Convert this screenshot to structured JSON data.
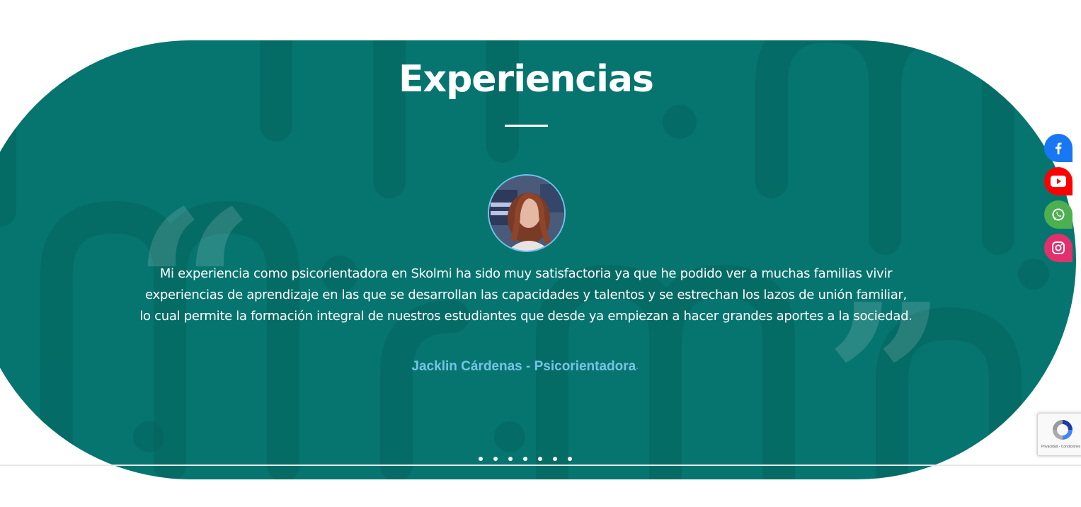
{
  "section": {
    "title": "Experiencias",
    "background_color": "#06756f",
    "accent_color": "#74c4e4"
  },
  "testimonial": {
    "quote": "Mi experiencia como psicorientadora en Skolmi ha sido muy satisfactoria ya que he podido ver a muchas familias vivir experiencias de aprendizaje en las que se desarrollan las capacidades y talentos y se estrechan los lazos de unión familiar, lo cual permite la formación integral de nuestros estudiantes que desde ya empiezan a hacer grandes aportes a la sociedad.",
    "author": "Jacklin Cárdenas - Psicorientadora",
    "author_separator": "-",
    "open_quote_glyph": "“",
    "close_quote_glyph": "”"
  },
  "carousel": {
    "dot_count": 7,
    "active_index": 0
  },
  "social": [
    {
      "name": "facebook",
      "icon": "facebook-icon",
      "color": "#1877f2"
    },
    {
      "name": "youtube",
      "icon": "youtube-icon",
      "color": "#ff0000"
    },
    {
      "name": "whatsapp",
      "icon": "whatsapp-icon",
      "color": "#4caf50"
    },
    {
      "name": "instagram",
      "icon": "instagram-icon",
      "color": "#e1306c"
    }
  ],
  "recaptcha": {
    "text": "Privacidad - Condiciones"
  }
}
